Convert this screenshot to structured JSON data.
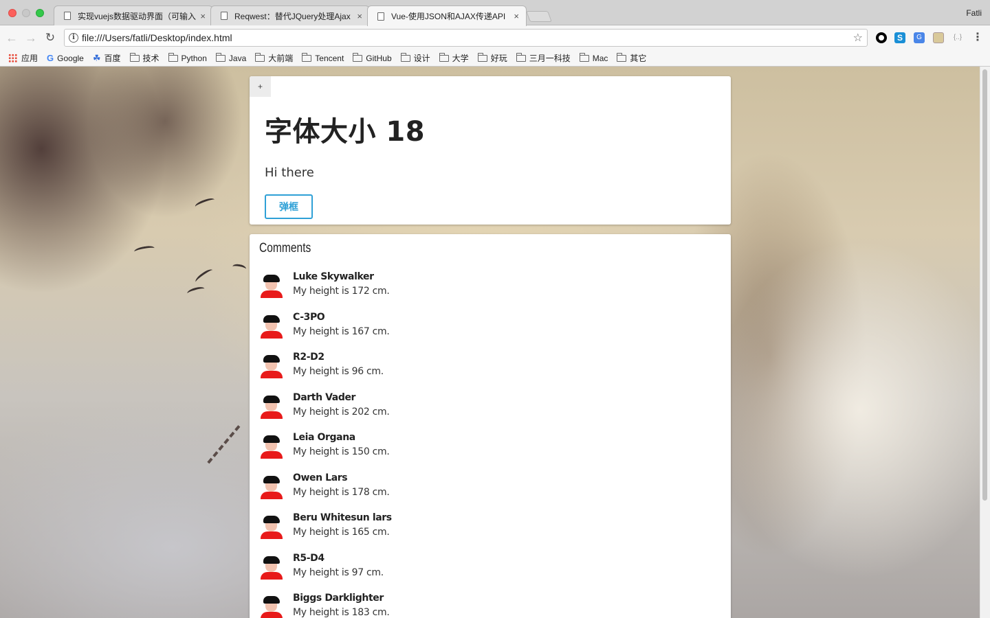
{
  "browser": {
    "tabs": [
      {
        "title": "实现vuejs数据驱动界面（可输入",
        "close": "×"
      },
      {
        "title": "Reqwest：替代JQuery处理Ajax",
        "close": "×"
      },
      {
        "title": "Vue-使用JSON和AJAX传递API",
        "close": "×"
      }
    ],
    "active_tab": 2,
    "profile_name": "Fatli",
    "url": "file:///Users/fatli/Desktop/index.html",
    "bookmarks": [
      "应用",
      "Google",
      "百度",
      "技术",
      "Python",
      "Java",
      "大前端",
      "Tencent",
      "GitHub",
      "设计",
      "大学",
      "好玩",
      "三月一科技",
      "Mac",
      "其它"
    ],
    "icons": {
      "back": "arrow-left-icon",
      "forward": "arrow-right-icon",
      "reload": "reload-icon",
      "info": "info-icon",
      "star": "star-icon",
      "menu": "kebab-menu-icon"
    }
  },
  "page": {
    "plus_label": "+",
    "heading": "字体大小 18",
    "greeting": "Hi there",
    "alert_button": "弹框",
    "comments_title": "Comments",
    "comments": [
      {
        "name": "Luke Skywalker",
        "text": "My height is 172 cm."
      },
      {
        "name": "C-3PO",
        "text": "My height is 167 cm."
      },
      {
        "name": "R2-D2",
        "text": "My height is 96 cm."
      },
      {
        "name": "Darth Vader",
        "text": "My height is 202 cm."
      },
      {
        "name": "Leia Organa",
        "text": "My height is 150 cm."
      },
      {
        "name": "Owen Lars",
        "text": "My height is 178 cm."
      },
      {
        "name": "Beru Whitesun lars",
        "text": "My height is 165 cm."
      },
      {
        "name": "R5-D4",
        "text": "My height is 97 cm."
      },
      {
        "name": "Biggs Darklighter",
        "text": "My height is 183 cm."
      }
    ]
  },
  "colors": {
    "accent": "#2ea0d6",
    "avatar_shirt": "#e81a1a"
  }
}
